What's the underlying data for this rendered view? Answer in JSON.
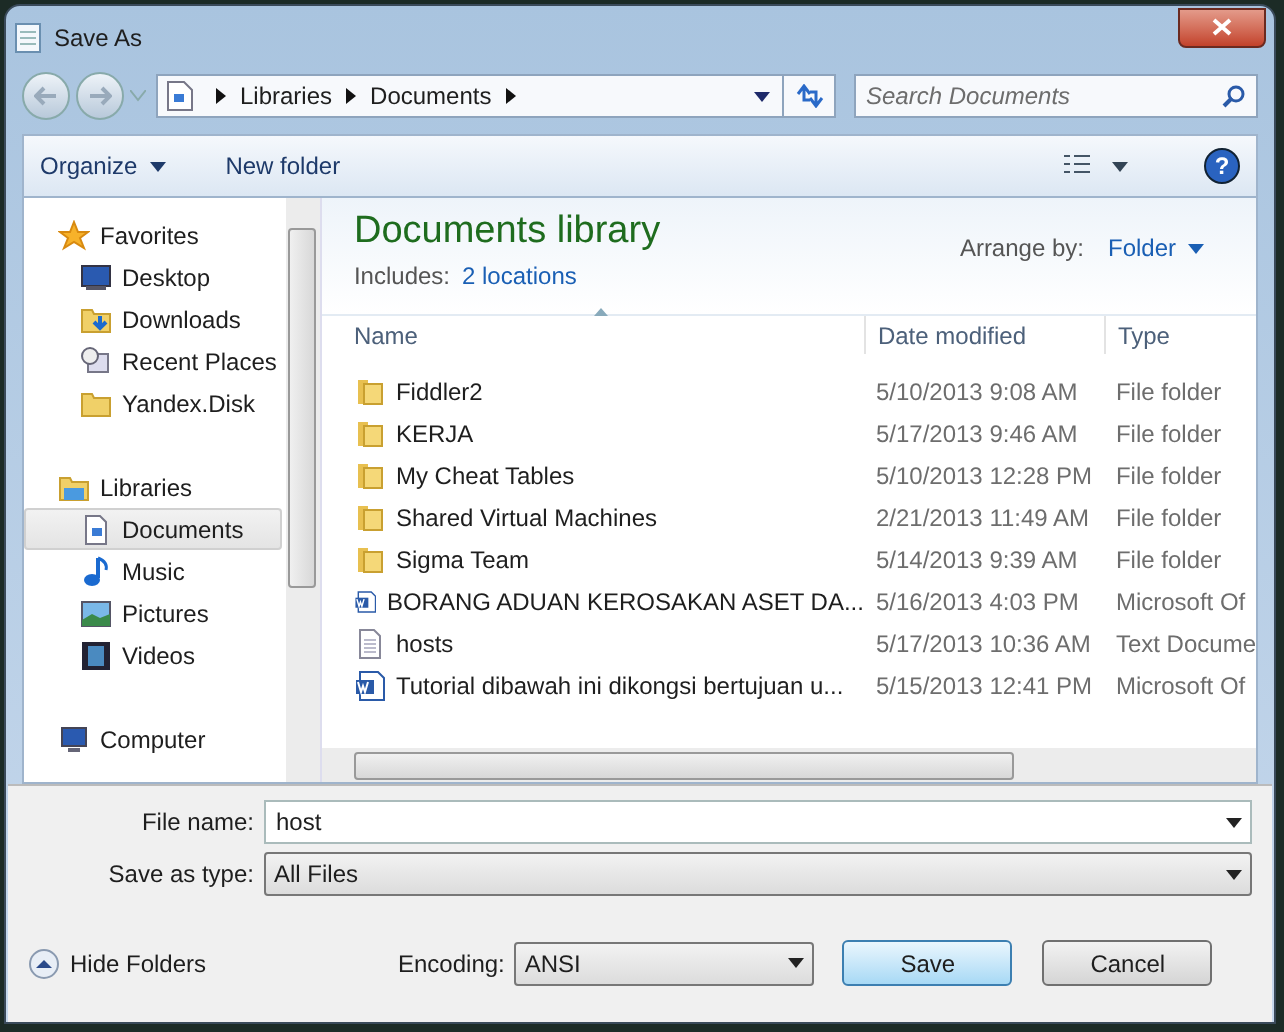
{
  "window": {
    "title": "Save As"
  },
  "address": {
    "crumbs": [
      "Libraries",
      "Documents"
    ]
  },
  "search": {
    "placeholder": "Search Documents"
  },
  "toolbar": {
    "organize": "Organize",
    "new_folder": "New folder",
    "help": "?"
  },
  "nav": [
    {
      "kind": "header",
      "label": "Favorites",
      "selected": false
    },
    {
      "kind": "item",
      "label": "Desktop",
      "selected": false
    },
    {
      "kind": "item",
      "label": "Downloads",
      "selected": false
    },
    {
      "kind": "item",
      "label": "Recent Places",
      "selected": false
    },
    {
      "kind": "item",
      "label": "Yandex.Disk",
      "selected": false
    },
    {
      "kind": "gap"
    },
    {
      "kind": "header",
      "label": "Libraries",
      "selected": false
    },
    {
      "kind": "item",
      "label": "Documents",
      "selected": true
    },
    {
      "kind": "item",
      "label": "Music",
      "selected": false
    },
    {
      "kind": "item",
      "label": "Pictures",
      "selected": false
    },
    {
      "kind": "item",
      "label": "Videos",
      "selected": false
    },
    {
      "kind": "gap"
    },
    {
      "kind": "header",
      "label": "Computer",
      "selected": false
    }
  ],
  "library": {
    "title": "Documents library",
    "includes_label": "Includes:",
    "includes_link": "2 locations",
    "arrange_label": "Arrange by:",
    "arrange_value": "Folder"
  },
  "table": {
    "columns": [
      "Name",
      "Date modified",
      "Type"
    ],
    "rows": [
      {
        "kind": "folder",
        "name": "Fiddler2",
        "date": "5/10/2013 9:08 AM",
        "type": "File folder"
      },
      {
        "kind": "folder",
        "name": "KERJA",
        "date": "5/17/2013 9:46 AM",
        "type": "File folder"
      },
      {
        "kind": "folder",
        "name": "My Cheat Tables",
        "date": "5/10/2013 12:28 PM",
        "type": "File folder"
      },
      {
        "kind": "folder",
        "name": "Shared Virtual Machines",
        "date": "2/21/2013 11:49 AM",
        "type": "File folder"
      },
      {
        "kind": "folder",
        "name": "Sigma Team",
        "date": "5/14/2013 9:39 AM",
        "type": "File folder"
      },
      {
        "kind": "word",
        "name": "BORANG ADUAN KEROSAKAN ASET DA...",
        "date": "5/16/2013 4:03 PM",
        "type": "Microsoft Of"
      },
      {
        "kind": "text",
        "name": "hosts",
        "date": "5/17/2013 10:36 AM",
        "type": "Text Docume"
      },
      {
        "kind": "word",
        "name": "Tutorial dibawah ini dikongsi bertujuan u...",
        "date": "5/15/2013 12:41 PM",
        "type": "Microsoft Of"
      }
    ]
  },
  "form": {
    "file_name_label": "File name:",
    "file_name": "host",
    "type_label": "Save as type:",
    "type_value": "All Files",
    "encoding_label": "Encoding:",
    "encoding_value": "ANSI"
  },
  "hide_folders": "Hide Folders",
  "buttons": [
    "Save",
    "Cancel"
  ]
}
